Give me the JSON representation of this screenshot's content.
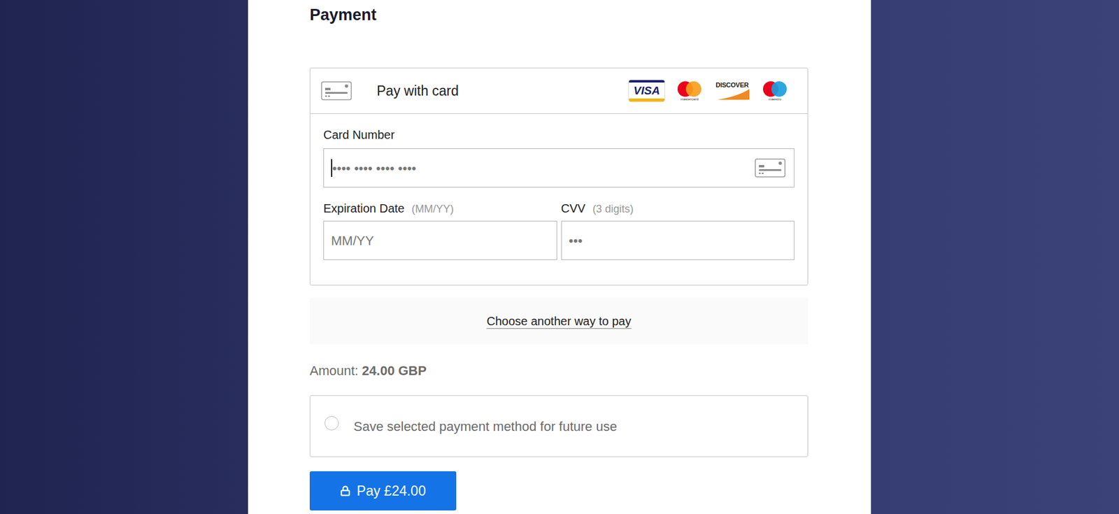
{
  "heading": "Payment",
  "card_method": {
    "label": "Pay with card",
    "brands": [
      {
        "name": "VISA",
        "kind": "visa"
      },
      {
        "name": "mastercard",
        "kind": "mastercard"
      },
      {
        "name": "DISCOVER",
        "kind": "discover"
      },
      {
        "name": "maestro",
        "kind": "maestro"
      }
    ]
  },
  "card_number": {
    "label": "Card Number",
    "placeholder": "•••• •••• •••• ••••",
    "focused": true
  },
  "expiration": {
    "label": "Expiration Date",
    "hint": "(MM/YY)",
    "placeholder": "MM/YY",
    "focused": false
  },
  "cvv": {
    "label": "CVV",
    "hint": "(3 digits)",
    "placeholder": "•••",
    "focused": false
  },
  "other_method": {
    "label": "Choose another way to pay"
  },
  "amount": {
    "label": "Amount:",
    "value": "24.00 GBP"
  },
  "save": {
    "label": "Save selected payment method for future use",
    "checked": false
  },
  "pay_button": {
    "label": "Pay £24.00"
  }
}
